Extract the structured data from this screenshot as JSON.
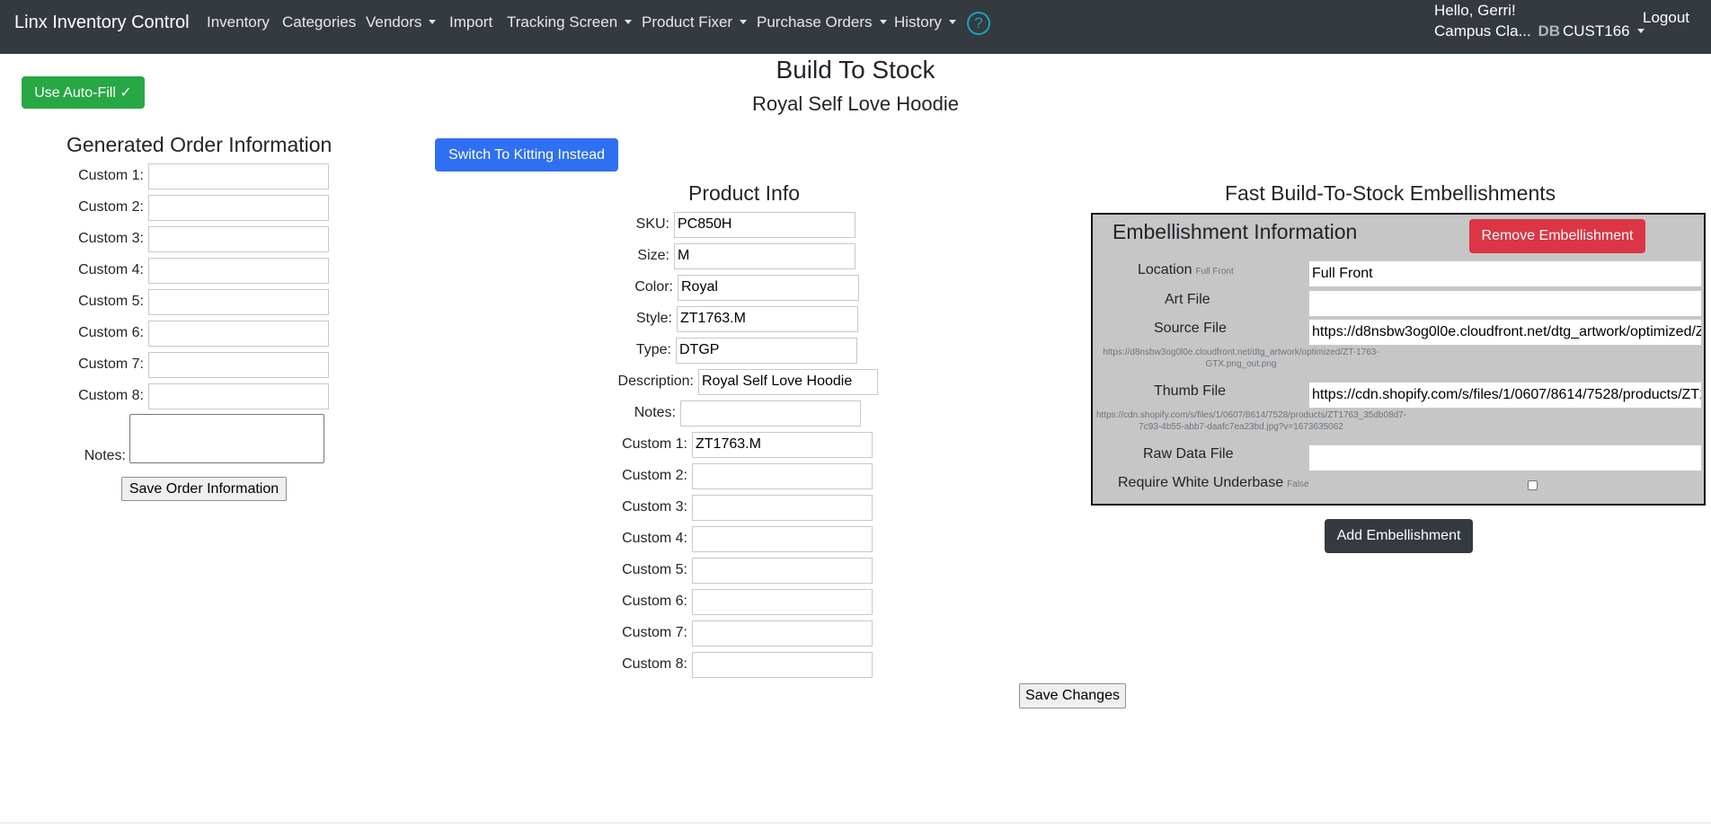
{
  "navbar": {
    "brand": "Linx Inventory Control",
    "items": [
      {
        "label": "Inventory",
        "dropdown": false
      },
      {
        "label": "Categories",
        "dropdown": false
      },
      {
        "label": "Vendors",
        "dropdown": true
      },
      {
        "label": "Import",
        "dropdown": false
      },
      {
        "label": "Tracking Screen",
        "dropdown": true
      },
      {
        "label": "Product Fixer",
        "dropdown": true
      },
      {
        "label": "Purchase Orders",
        "dropdown": true
      },
      {
        "label": "History",
        "dropdown": true
      }
    ],
    "help_icon": "?",
    "greeting": "Hello, Gerri!",
    "campus": "Campus Cla...",
    "db_label": "DB",
    "customer": "CUST166",
    "logout": "Logout"
  },
  "page": {
    "title": "Build To Stock",
    "subtitle": "Royal Self Love Hoodie",
    "autofill_button": "Use Auto-Fill ✓",
    "switch_button": "Switch To Kitting Instead",
    "save_changes": "Save Changes"
  },
  "order_info": {
    "title": "Generated Order Information",
    "fields": [
      {
        "label": "Custom 1:",
        "value": ""
      },
      {
        "label": "Custom 2:",
        "value": ""
      },
      {
        "label": "Custom 3:",
        "value": ""
      },
      {
        "label": "Custom 4:",
        "value": ""
      },
      {
        "label": "Custom 5:",
        "value": ""
      },
      {
        "label": "Custom 6:",
        "value": ""
      },
      {
        "label": "Custom 7:",
        "value": ""
      },
      {
        "label": "Custom 8:",
        "value": ""
      }
    ],
    "notes_label": "Notes:",
    "save_button": "Save Order Information"
  },
  "product_info": {
    "title": "Product Info",
    "fields": [
      {
        "label": "SKU:",
        "value": "PC850H"
      },
      {
        "label": "Size:",
        "value": "M"
      },
      {
        "label": "Color:",
        "value": "Royal"
      },
      {
        "label": "Style:",
        "value": "ZT1763.M"
      },
      {
        "label": "Type:",
        "value": "DTGP"
      },
      {
        "label": "Description:",
        "value": "Royal Self Love Hoodie"
      },
      {
        "label": "Notes:",
        "value": ""
      },
      {
        "label": "Custom 1:",
        "value": "ZT1763.M"
      },
      {
        "label": "Custom 2:",
        "value": ""
      },
      {
        "label": "Custom 3:",
        "value": ""
      },
      {
        "label": "Custom 4:",
        "value": ""
      },
      {
        "label": "Custom 5:",
        "value": ""
      },
      {
        "label": "Custom 6:",
        "value": ""
      },
      {
        "label": "Custom 7:",
        "value": ""
      },
      {
        "label": "Custom 8:",
        "value": ""
      }
    ]
  },
  "embellishments": {
    "title": "Fast Build-To-Stock Embellishments",
    "panel_title": "Embellishment Information",
    "remove_button": "Remove Embellishment",
    "location_label": "Location",
    "location_small": "Full Front",
    "location_value": "Full Front",
    "art_label": "Art File",
    "art_value": "",
    "source_label": "Source File",
    "source_value": "https://d8nsbw3og0l0e.cloudfront.net/dtg_artwork/optimized/ZT-1763-GTX.png_out.png",
    "source_note": "https://d8nsbw3og0l0e.cloudfront.net/dtg_artwork/optimized/ZT-1763-GTX.png_out.png",
    "thumb_label": "Thumb File",
    "thumb_value": "https://cdn.shopify.com/s/files/1/0607/8614/7528/products/ZT1763_35db08d7-7c93-4b55-abb7-daafc7ea23bd.jpg?v=1673635062",
    "thumb_note": "https://cdn.shopify.com/s/files/1/0607/8614/7528/products/ZT1763_35db08d7-7c93-4b55-abb7-daafc7ea23bd.jpg?v=1673635062",
    "raw_label": "Raw Data File",
    "raw_value": "",
    "underbase_label": "Require White Underbase",
    "underbase_small": "False",
    "underbase_checked": false,
    "add_button": "Add Embellishment"
  }
}
